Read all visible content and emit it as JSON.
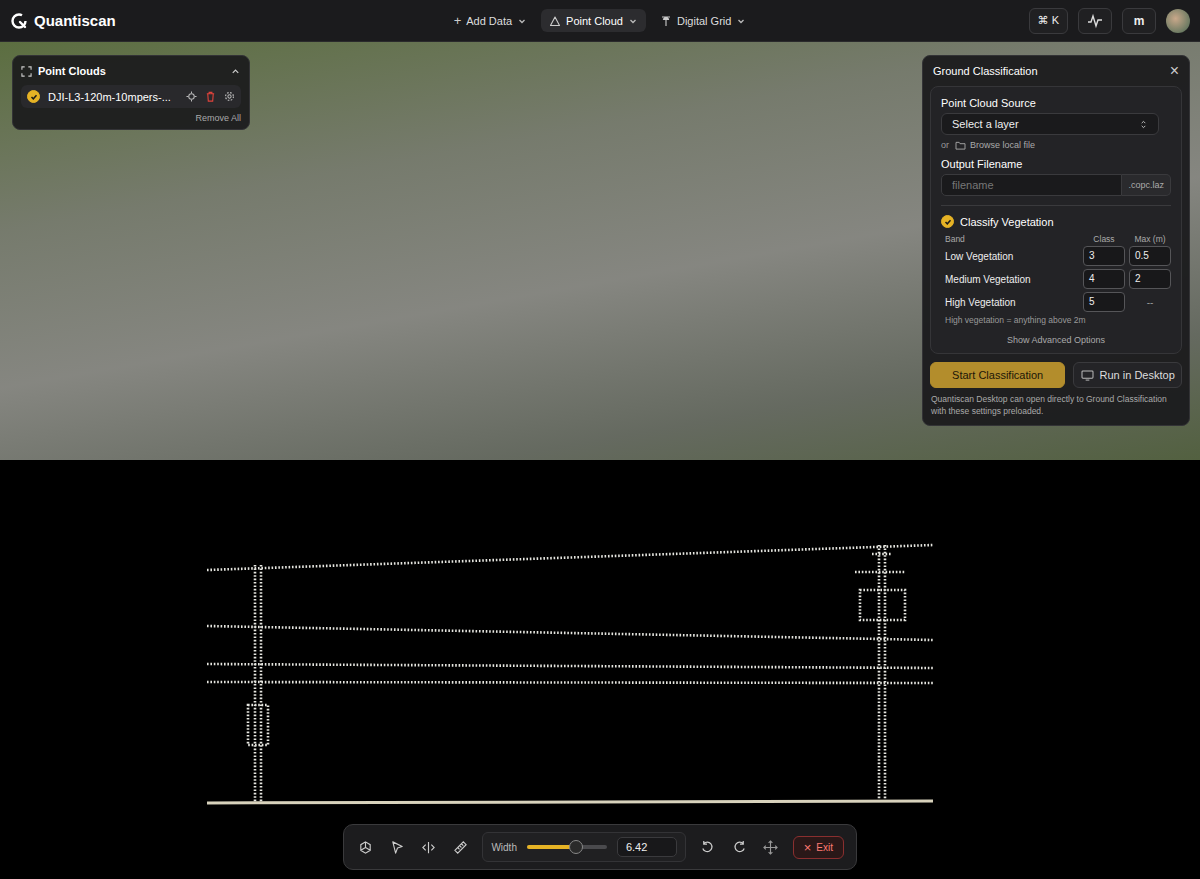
{
  "app": {
    "name": "Quantiscan"
  },
  "nav": {
    "menus": [
      {
        "label": "Add Data",
        "kind": "add",
        "icon": "+",
        "selected": false
      },
      {
        "label": "Point Cloud",
        "kind": "pointcloud",
        "selected": true
      },
      {
        "label": "Digital Grid",
        "kind": "grid",
        "selected": false
      }
    ],
    "shortcut": "⌘ K",
    "user_initial": "m"
  },
  "point_clouds_panel": {
    "title": "Point Clouds",
    "expanded": true,
    "layers": [
      {
        "name": "DJI-L3-120m-10mpers-...",
        "visible": true
      }
    ],
    "remove_all": "Remove All"
  },
  "ground_panel": {
    "title": "Ground Classification",
    "close": "×",
    "source": {
      "label": "Point Cloud Source",
      "placeholder": "Select a layer",
      "or": "or",
      "browse": "Browse local file"
    },
    "output": {
      "label": "Output Filename",
      "placeholder": "filename",
      "suffix": ".copc.laz"
    },
    "vegetation": {
      "label": "Classify Vegetation",
      "checked": true,
      "columns": [
        "Band",
        "Class",
        "Max (m)"
      ],
      "bands": [
        {
          "name": "Low Vegetation",
          "class": "3",
          "max": "0.5",
          "editable_max": true
        },
        {
          "name": "Medium Vegetation",
          "class": "4",
          "max": "2",
          "editable_max": true
        },
        {
          "name": "High Vegetation",
          "class": "5",
          "max": "--",
          "editable_max": false
        }
      ],
      "note": "High vegetation = anything above 2m",
      "advanced": "Show Advanced Options"
    },
    "buttons": [
      {
        "label": "Start Classification",
        "kind": "primary"
      },
      {
        "label": "Run in Desktop",
        "kind": "desktop"
      }
    ],
    "footnote": "Quantiscan Desktop can open directly to Ground Classification with these settings preloaded."
  },
  "toolbar": {
    "tools": [
      {
        "kind": "orbit"
      },
      {
        "kind": "select"
      },
      {
        "kind": "split"
      },
      {
        "kind": "measure"
      }
    ],
    "width": {
      "label": "Width",
      "level": 0.61,
      "value": "6.42"
    },
    "history": [
      {
        "kind": "undo"
      },
      {
        "kind": "redo"
      }
    ],
    "extra": [
      {
        "kind": "move"
      }
    ],
    "exit": {
      "icon": "×",
      "label": "Exit"
    }
  }
}
